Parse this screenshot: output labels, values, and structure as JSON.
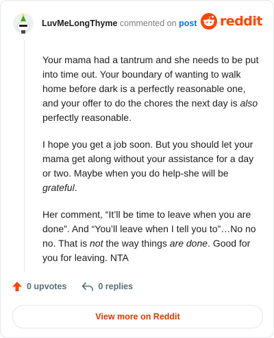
{
  "header": {
    "username": "LuvMeLongThyme",
    "action_text": "commented on",
    "post_link": "post",
    "brand": "reddit"
  },
  "comment": {
    "p1": {
      "a": "Your mama had a tantrum and she needs to be put into time out. Your boundary of wanting to walk home before dark is a perfectly reasonable one, and your offer to do the chores the next day is ",
      "em": "also",
      "b": " perfectly reasonable."
    },
    "p2": {
      "a": "I hope you get a job soon. But you should let your mama get along without your assistance for a day or two. Maybe when you do help-she will be ",
      "em": "grateful",
      "b": "."
    },
    "p3": {
      "a": "Her comment, “It’ll be time to leave when you are done”. And “You’ll leave when I tell you to”…No no no. That is ",
      "em1": "not",
      "b": " the way things ",
      "em2": "are done",
      "c": ". Good for you for leaving. NTA"
    }
  },
  "actions": {
    "upvotes": "0 upvotes",
    "replies": "0 replies"
  },
  "footer": {
    "view_more": "View more on Reddit"
  },
  "colors": {
    "brand": "#ff4500",
    "link": "#0079d3",
    "view_more": "#d93a00"
  },
  "icons": {
    "upvote": "upvote-arrow-icon",
    "reply": "reply-arrow-icon",
    "logo": "reddit-snoo-icon"
  }
}
